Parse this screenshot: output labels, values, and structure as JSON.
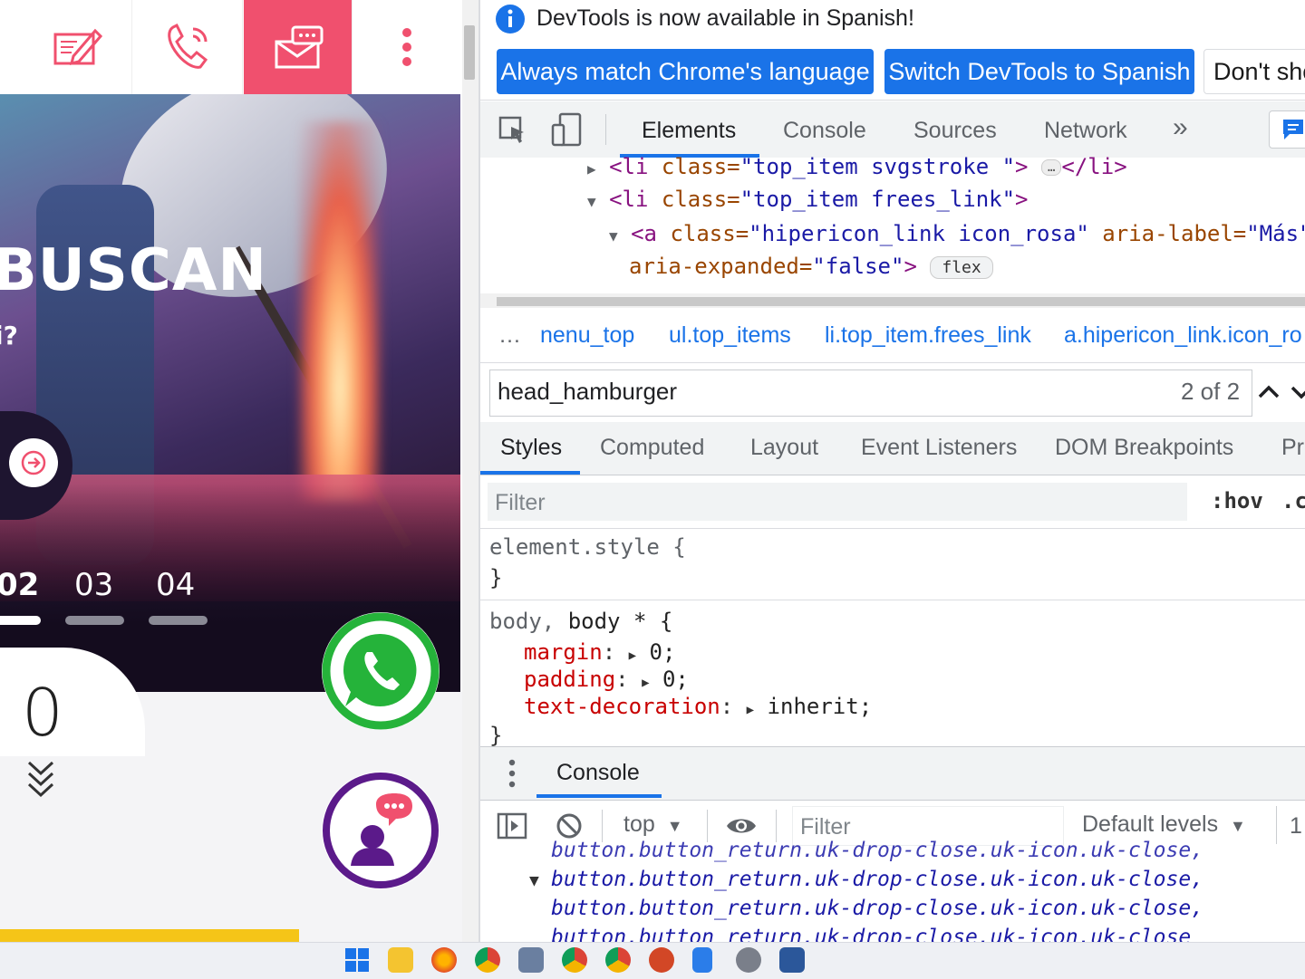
{
  "site": {
    "hero_title": "BUSCAN",
    "hero_subtitle": "i?",
    "slides": [
      "02",
      "03",
      "04"
    ],
    "scroll_hint_number": "0",
    "accent_pink": "#f0506e",
    "whatsapp_green": "#25b33a",
    "chat_purple": "#5b1a8a"
  },
  "devtools": {
    "info_message": "DevTools is now available in Spanish!",
    "btn_match": "Always match Chrome's language",
    "btn_switch": "Switch DevTools to Spanish",
    "btn_dont": "Don't sho",
    "tabs": [
      "Elements",
      "Console",
      "Sources",
      "Network",
      "»"
    ],
    "dom": {
      "l1_tag_open": "<li",
      "l1_attr": " class=",
      "l1_val": "\"top_item  svgstroke \"",
      "l1_rest": ">",
      "l1_close": "</li>",
      "l2_tag_open": "<li",
      "l2_attr": " class=",
      "l2_val": "\"top_item   frees_link\"",
      "l2_rest": ">",
      "l3_tag_open": "<a",
      "l3_attr1": " class=",
      "l3_val1": "\"hipericon_link icon_rosa\"",
      "l3_attr2": " aria-label=",
      "l3_val2": "\"Más\"",
      "l4_attr": "aria-expanded=",
      "l4_val": "\"false\"",
      "l4_rest": ">",
      "flex_badge": "flex",
      "ellipsis_badge": "…"
    },
    "breadcrumbs": [
      "…",
      "nenu_top",
      "ul.top_items",
      "li.top_item.frees_link",
      "a.hipericon_link.icon_ro"
    ],
    "search": {
      "value": "head_hamburger",
      "count": "2 of 2"
    },
    "subtabs": [
      "Styles",
      "Computed",
      "Layout",
      "Event Listeners",
      "DOM Breakpoints",
      "Pr"
    ],
    "filter_placeholder": "Filter",
    "hov": ":hov",
    "cls": ".c",
    "styles": {
      "rule1_selector": "element.style {",
      "rule1_close": "}",
      "rule2_selector_a": "body,",
      "rule2_selector_b": " body",
      "rule2_selector_c": " * {",
      "props": [
        {
          "name": "margin",
          "value": "0;"
        },
        {
          "name": "padding",
          "value": "0;"
        },
        {
          "name": "text-decoration",
          "value": "inherit;"
        }
      ],
      "rule2_close": "}"
    },
    "console_tab": "Console",
    "console_context": "top",
    "console_filter": "Filter",
    "console_levels": "Default levels",
    "console_count": "1",
    "console_lines": [
      "button.button_return.uk-drop-close.uk-icon.uk-close,",
      "button.button_return.uk-drop-close.uk-icon.uk-close,",
      "button.button_return.uk-drop-close.uk-icon.uk-close,",
      "button.button_return.uk-drop-close.uk-icon.uk-close"
    ]
  }
}
